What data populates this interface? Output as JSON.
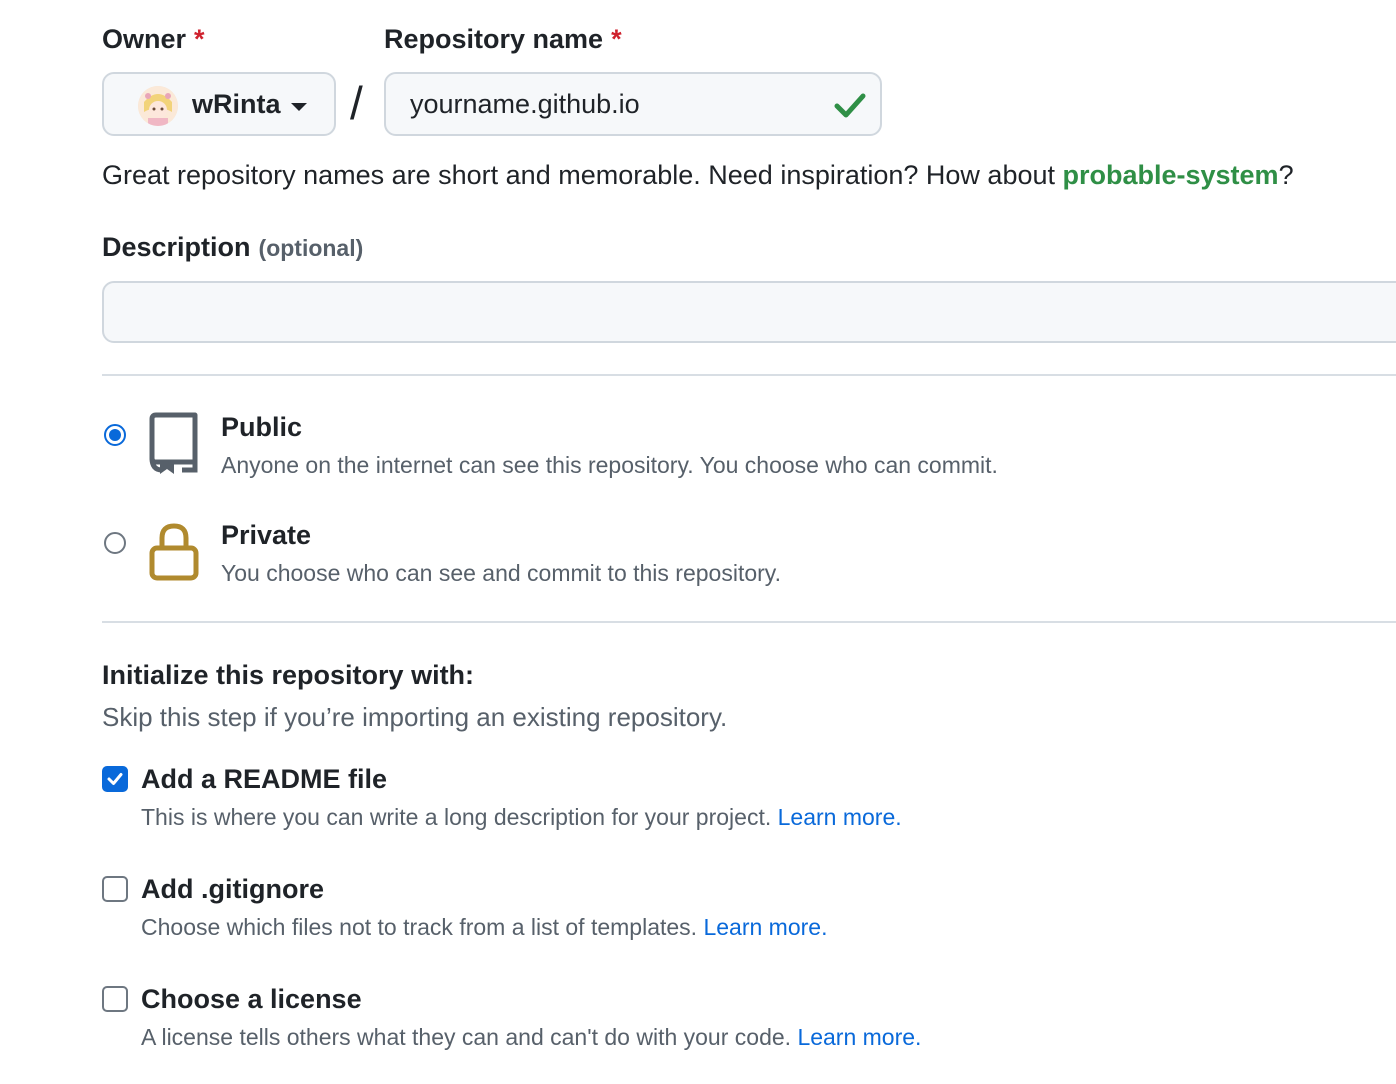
{
  "owner": {
    "label": "Owner",
    "required_mark": "*",
    "selected": "wRinta",
    "avatar": "avatar-image"
  },
  "repo_name": {
    "label": "Repository name",
    "required_mark": "*",
    "value": "yourname.github.io",
    "status_icon": "check-icon"
  },
  "separator": "/",
  "hint": {
    "text": "Great repository names are short and memorable. Need inspiration? How about ",
    "suggestion": "probable-system",
    "end": "?"
  },
  "description": {
    "label": "Description",
    "optional": "(optional)",
    "value": ""
  },
  "visibility": {
    "public": {
      "title": "Public",
      "desc": "Anyone on the internet can see this repository. You choose who can commit.",
      "icon": "repo-icon",
      "checked": true
    },
    "private": {
      "title": "Private",
      "desc": "You choose who can see and commit to this repository.",
      "icon": "lock-icon",
      "checked": false
    }
  },
  "init": {
    "title": "Initialize this repository with:",
    "subtitle": "Skip this step if you’re importing an existing repository.",
    "options": [
      {
        "title": "Add a README file",
        "desc": "This is where you can write a long description for your project.",
        "link": "Learn more.",
        "checked": true
      },
      {
        "title": "Add .gitignore",
        "desc": "Choose which files not to track from a list of templates.",
        "link": "Learn more.",
        "checked": false
      },
      {
        "title": "Choose a license",
        "desc": "A license tells others what they can and can't do with your code.",
        "link": "Learn more.",
        "checked": false
      }
    ]
  },
  "colors": {
    "accent": "#0969da",
    "success": "#2f8f46",
    "danger": "#cf222e",
    "lock": "#b08a2e"
  }
}
